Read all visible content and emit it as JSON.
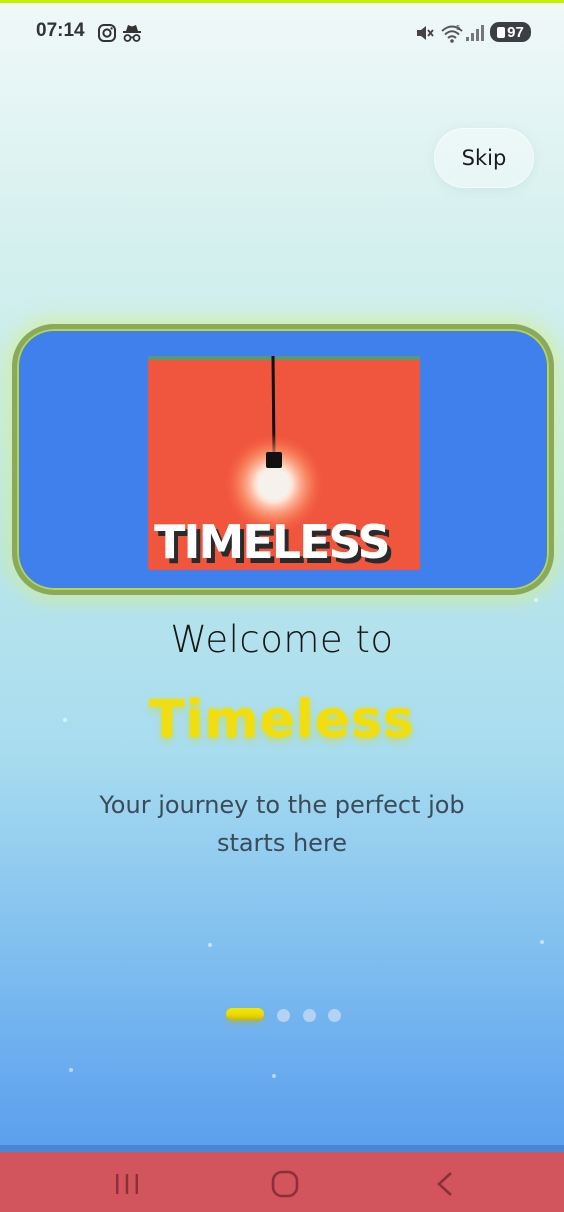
{
  "status_bar": {
    "time": "07:14",
    "battery": "97",
    "left_icons": [
      "instagram-icon",
      "incognito-icon"
    ],
    "right_icons": [
      "mute-icon",
      "wifi-icon",
      "signal-icon",
      "battery-icon"
    ]
  },
  "skip_button": {
    "label": "Skip"
  },
  "hero": {
    "image_text": "TIMELESS",
    "image_description_icon": "light-bulb-icon",
    "colors": {
      "card": "#4080ec",
      "image_background": "#f0553d",
      "border": "#8aa95a"
    }
  },
  "onboarding": {
    "welcome": "Welcome to",
    "app_name": "Timeless",
    "tagline": "Your journey to the perfect job starts here",
    "page_count": 4,
    "current_page": 1
  },
  "navigation": {
    "buttons": [
      "recent-apps-icon",
      "home-icon",
      "back-icon"
    ]
  },
  "colors": {
    "accent": "#f2dd10",
    "nav_bar": "#d2545c",
    "top_accent": "#c7f000"
  }
}
